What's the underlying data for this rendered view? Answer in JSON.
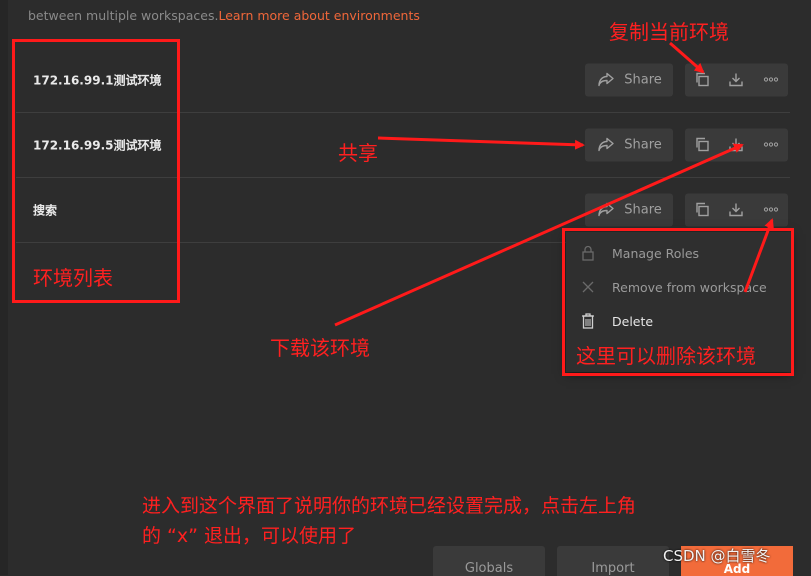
{
  "header": {
    "description": "between multiple workspaces.",
    "learn_more": "Learn more about environments"
  },
  "environments": [
    {
      "name": "172.16.99.1测试环境",
      "share_label": "Share"
    },
    {
      "name": "172.16.99.5测试环境",
      "share_label": "Share"
    },
    {
      "name": "搜索",
      "share_label": "Share"
    }
  ],
  "menu": {
    "manage_roles": "Manage Roles",
    "remove": "Remove from workspace",
    "delete": "Delete"
  },
  "footer": {
    "globals": "Globals",
    "import": "Import",
    "add": "Add"
  },
  "annotations": {
    "copy": "复制当前环境",
    "share": "共享",
    "list": "环境列表",
    "download": "下载该环境",
    "delete": "这里可以删除该环境",
    "note_line1": "进入到这个界面了说明你的环境已经设置完成，点击左上角",
    "note_line2": "的 “x” 退出，可以使用了"
  },
  "watermark": "CSDN @白雪冬",
  "colors": {
    "accent": "#f26b3a",
    "annotation": "#ff1a1a",
    "background": "#2c2c2c"
  }
}
